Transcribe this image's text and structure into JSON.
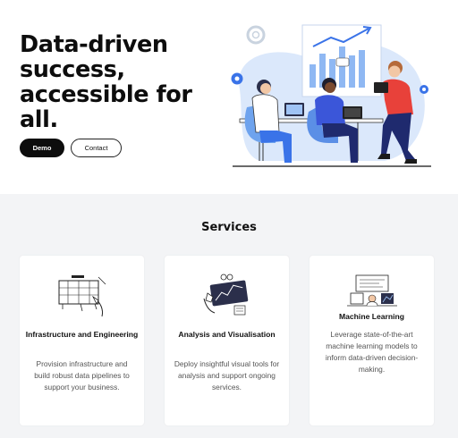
{
  "hero": {
    "title": "Data-driven success, accessible for all.",
    "demo_label": "Demo",
    "contact_label": "Contact"
  },
  "services": {
    "title": "Services",
    "cards": [
      {
        "title": "Infrastructure and Engineering",
        "description": "Provision infrastructure and build robust data pipelines to support your business.",
        "icon": "blueprint-icon"
      },
      {
        "title": "Analysis and Visualisation",
        "description": "Deploy insightful visual tools for analysis and support ongoing services.",
        "icon": "analytics-tablet-icon"
      },
      {
        "title": "Machine Learning",
        "description": "Leverage state-of-the-art machine learning models to inform data-driven decision-making.",
        "icon": "ml-workspace-icon"
      }
    ]
  },
  "colors": {
    "accent_blue": "#3a73e8",
    "light_blue": "#dbe8fb",
    "hero_red": "#e8413a",
    "services_bg": "#f3f4f6"
  }
}
